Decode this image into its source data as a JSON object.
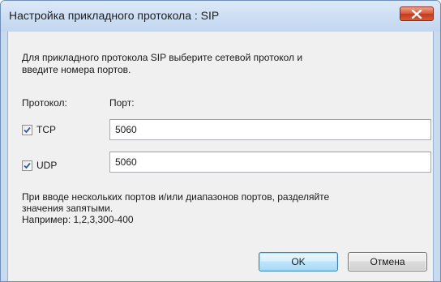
{
  "window": {
    "title": "Настройка прикладного протокола : SIP"
  },
  "instruction": {
    "line1": "Для прикладного протокола SIP выберите сетевой протокол и",
    "line2": "введите номера портов."
  },
  "headers": {
    "protocol": "Протокол:",
    "port": "Порт:"
  },
  "rows": [
    {
      "protocol": "TCP",
      "checked": true,
      "port": "5060"
    },
    {
      "protocol": "UDP",
      "checked": true,
      "port": "5060"
    }
  ],
  "hint": {
    "line1": "При вводе нескольких портов и/или диапазонов портов, разделяйте",
    "line2": "значения запятыми.",
    "line3": "Например: 1,2,3,300-400"
  },
  "buttons": {
    "ok": "OK",
    "cancel": "Отмена"
  },
  "icons": {
    "close": "close-icon",
    "checkmark": "checkmark-icon"
  },
  "colors": {
    "title_bar": "#cfe0f4",
    "close_button": "#d8583a",
    "client_background": "#f0f0f0",
    "ok_button_border": "#3c7fb1"
  }
}
